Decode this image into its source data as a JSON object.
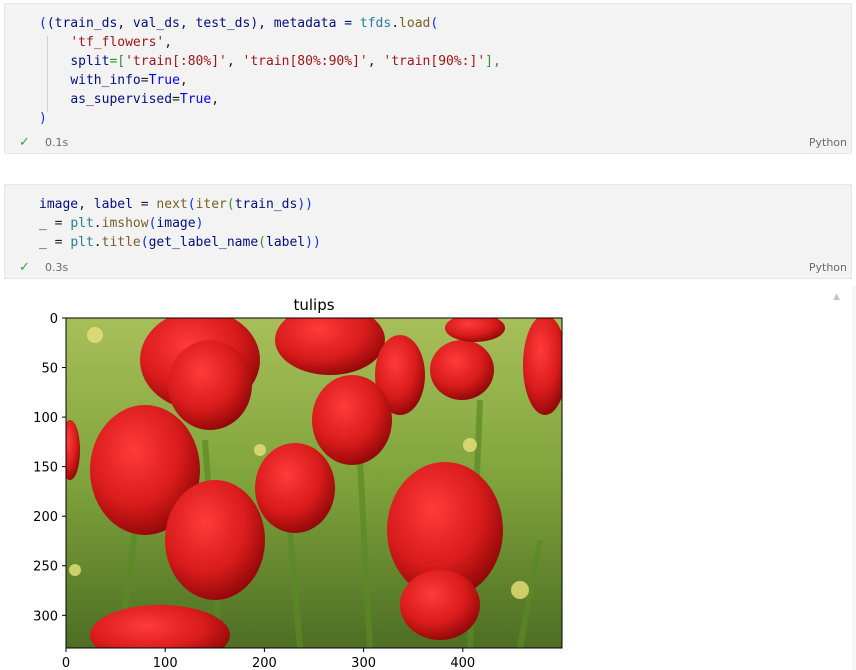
{
  "cells": [
    {
      "status": "0.1s",
      "language": "Python",
      "code": {
        "l1_a": "(train_ds, val_ds, test_ds), metadata = ",
        "l1_mod": "tfds",
        "l1_dot": ".",
        "l1_fn": "load",
        "l1_paren": "(",
        "l2_str": "'tf_flowers'",
        "l2_comma": ",",
        "l3_var": "split",
        "l3_eq": "=[",
        "l3_s1": "'train[:80%]'",
        "l3_c1": ", ",
        "l3_s2": "'train[80%:90%]'",
        "l3_c2": ", ",
        "l3_s3": "'train[90%:]'",
        "l3_end": "],",
        "l4_var": "with_info",
        "l4_eq": "=",
        "l4_kw": "True",
        "l4_comma": ",",
        "l5_var": "as_supervised",
        "l5_eq": "=",
        "l5_kw": "True",
        "l5_comma": ",",
        "l6_paren": ")"
      }
    },
    {
      "status": "0.3s",
      "language": "Python",
      "code": {
        "l1_v1": "image",
        "l1_c": ", ",
        "l1_v2": "label",
        "l1_eq": " = ",
        "l1_fn1": "next",
        "l1_p1": "(",
        "l1_fn2": "iter",
        "l1_p2": "(",
        "l1_v3": "train_ds",
        "l1_p3": "))",
        "l2_v": "_",
        "l2_eq": " = ",
        "l2_mod": "plt",
        "l2_dot": ".",
        "l2_fn": "imshow",
        "l2_p1": "(",
        "l2_arg": "image",
        "l2_p2": ")",
        "l3_v": "_",
        "l3_eq": " = ",
        "l3_mod": "plt",
        "l3_dot": ".",
        "l3_fn": "title",
        "l3_p1": "(",
        "l3_fn2": "get_label_name",
        "l3_p2": "(",
        "l3_arg": "label",
        "l3_p3": "))"
      }
    }
  ],
  "chart_data": {
    "type": "image",
    "title": "tulips",
    "xlim": [
      0,
      500
    ],
    "ylim": [
      333,
      0
    ],
    "xticks": [
      0,
      100,
      200,
      300,
      400
    ],
    "yticks": [
      0,
      50,
      100,
      150,
      200,
      250,
      300
    ],
    "xlabel": "",
    "ylabel": ""
  },
  "colors": {
    "tulip_red": "#d81b1b",
    "foliage_green": "#6c9a34",
    "check_green": "#3c9b43"
  }
}
